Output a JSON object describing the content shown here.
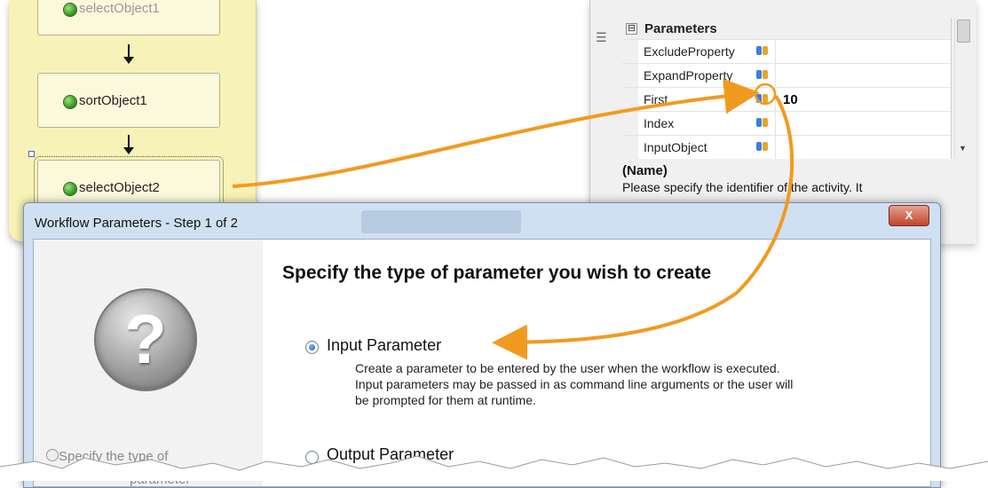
{
  "designer": {
    "activities": [
      {
        "label": "selectObject1"
      },
      {
        "label": "sortObject1"
      },
      {
        "label": "selectObject2"
      }
    ]
  },
  "property_grid": {
    "gutter_icon": "list-icon",
    "category": {
      "toggle": "⊟",
      "label": "Parameters"
    },
    "rows": [
      {
        "name": "ExcludeProperty",
        "value": ""
      },
      {
        "name": "ExpandProperty",
        "value": ""
      },
      {
        "name": "First",
        "value": "10"
      },
      {
        "name": "Index",
        "value": ""
      },
      {
        "name": "InputObject",
        "value": ""
      }
    ],
    "description": {
      "title": "(Name)",
      "text": "Please specify the identifier of the activity. It"
    }
  },
  "dialog": {
    "title": "Workflow Parameters - Step 1 of 2",
    "close_label": "X",
    "heading": "Specify the type of parameter you wish to create",
    "help_glyph": "?",
    "left_caption_line1": "Specify the type of",
    "left_caption_line2": "parameter",
    "options": [
      {
        "label": "Input Parameter",
        "checked": true,
        "description": [
          "Create a parameter to be entered by the user when the workflow is executed.",
          "Input parameters may be passed in as command line arguments or the user will",
          "be prompted for them at runtime."
        ]
      },
      {
        "label": "Output Parameter",
        "checked": false,
        "description": []
      }
    ]
  },
  "colors": {
    "arrow": "#f29a1f",
    "designer_bg": "#f7f2b7",
    "dialog_frame": "#cfe0f2"
  }
}
